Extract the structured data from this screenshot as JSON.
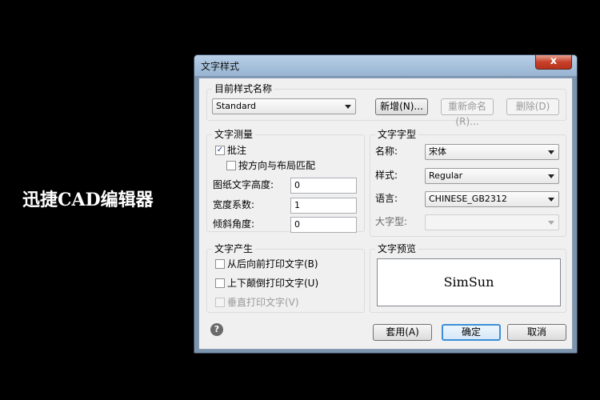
{
  "app_label": "迅捷CAD编辑器",
  "dialog": {
    "title": "文字样式",
    "close_label": "x"
  },
  "current_style": {
    "group_title": "目前样式名称",
    "style_name": "Standard",
    "new_button": "新增(N)...",
    "rename_button": "重新命名(R)...",
    "delete_button": "删除(D)"
  },
  "measure": {
    "group_title": "文字测量",
    "annotate_label": "批注",
    "annotate_checked": true,
    "match_layout_label": "按方向与布局匹配",
    "match_layout_checked": false,
    "height_label": "图纸文字高度:",
    "height_value": "0",
    "width_label": "宽度系数:",
    "width_value": "1",
    "oblique_label": "倾斜角度:",
    "oblique_value": "0"
  },
  "font": {
    "group_title": "文字字型",
    "name_label": "名称:",
    "name_value": "宋体",
    "style_label": "样式:",
    "style_value": "Regular",
    "language_label": "语言:",
    "language_value": "CHINESE_GB2312",
    "bigfont_label": "大字型:",
    "bigfont_value": ""
  },
  "generate": {
    "group_title": "文字产生",
    "backwards_label": "从后向前打印文字(B)",
    "backwards_checked": false,
    "upside_down_label": "上下颠倒打印文字(U)",
    "upside_down_checked": false,
    "vertical_label": "垂直打印文字(V)",
    "vertical_checked": false
  },
  "preview": {
    "group_title": "文字预览",
    "sample_text": "SimSun"
  },
  "footer": {
    "help_icon": "?",
    "apply_button": "套用(A)",
    "ok_button": "确定",
    "cancel_button": "取消"
  }
}
